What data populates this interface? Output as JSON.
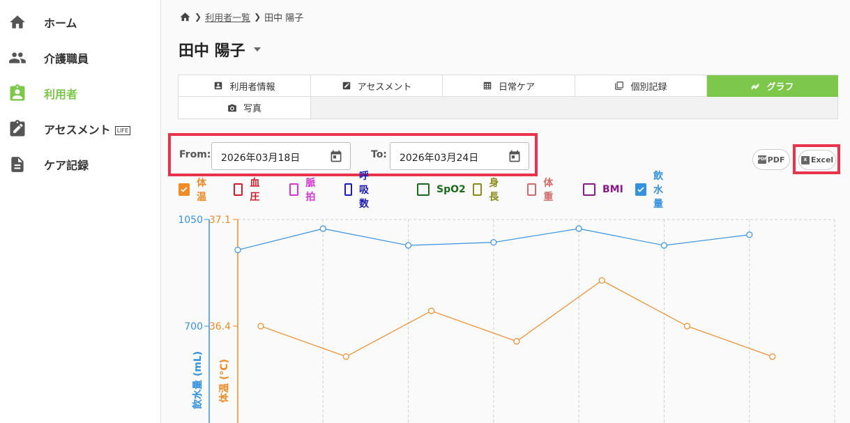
{
  "sidebar": {
    "items": [
      {
        "label": "ホーム",
        "icon": "home-icon"
      },
      {
        "label": "介護職員",
        "icon": "people-icon"
      },
      {
        "label": "利用者",
        "icon": "clipboard-person-icon",
        "active": true
      },
      {
        "label": "アセスメント",
        "icon": "edit-document-icon",
        "badge": "LIFE"
      },
      {
        "label": "ケア記録",
        "icon": "document-icon"
      }
    ]
  },
  "breadcrumb": {
    "home_icon": "home-icon",
    "link": "利用者一覧",
    "current": "田中 陽子"
  },
  "page": {
    "title": "田中 陽子"
  },
  "tabs": [
    {
      "label": "利用者情報",
      "icon": "person-badge-icon"
    },
    {
      "label": "アセスメント",
      "icon": "edit-icon"
    },
    {
      "label": "日常ケア",
      "icon": "calendar-grid-icon"
    },
    {
      "label": "個別記録",
      "icon": "copy-icon"
    },
    {
      "label": "グラフ",
      "icon": "chart-line-icon",
      "active": true
    },
    {
      "label": "写真",
      "icon": "camera-icon"
    }
  ],
  "date_range": {
    "from_label": "From:",
    "from_value": "2026年03月18日",
    "to_label": "To:",
    "to_value": "2026年03月24日"
  },
  "export": {
    "pdf_label": "PDF",
    "pdf_badge": "PDF",
    "excel_label": "Excel",
    "excel_badge": "X"
  },
  "metrics": [
    {
      "label": "体温",
      "color": "#f08a24",
      "checked": true
    },
    {
      "label": "血圧",
      "color": "#d11a2a",
      "checked": false
    },
    {
      "label": "脈拍",
      "color": "#d633d6",
      "checked": false
    },
    {
      "label": "呼吸数",
      "color": "#1a1ab8",
      "checked": false
    },
    {
      "label": "SpO2",
      "color": "#1a6b1a",
      "checked": false
    },
    {
      "label": "身長",
      "color": "#8a8a1a",
      "checked": false
    },
    {
      "label": "体重",
      "color": "#d06a6a",
      "checked": false
    },
    {
      "label": "BMI",
      "color": "#8a1a8a",
      "checked": false
    },
    {
      "label": "飲水量",
      "color": "#3592e0",
      "checked": true
    }
  ],
  "chart_data": {
    "type": "line",
    "grid": true,
    "colors": {
      "water": "#3592e0",
      "temp": "#f08a24"
    },
    "y_left_label": "飲水量 (mL)",
    "y_left_ticks": [
      1050,
      700
    ],
    "y_left_range": [
      350,
      1050
    ],
    "y_right_label": "体温 (°C)",
    "y_right_ticks": [
      "37.1",
      "36.4"
    ],
    "y_right_range": [
      35.7,
      37.1
    ],
    "series": [
      {
        "name": "飲水量",
        "axis": "left",
        "offset": 0,
        "values": [
          950,
          1020,
          965,
          975,
          1020,
          965,
          1000
        ]
      },
      {
        "name": "体温",
        "axis": "right",
        "offset": 0.27,
        "values": [
          36.4,
          36.2,
          36.5,
          36.3,
          36.7,
          36.4,
          36.2
        ]
      }
    ]
  }
}
